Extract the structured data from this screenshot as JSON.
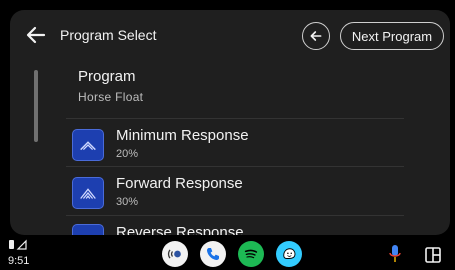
{
  "header": {
    "title": "Program Select",
    "next_label": "Next Program"
  },
  "program": {
    "label": "Program",
    "value": "Horse Float"
  },
  "list": [
    {
      "title": "Minimum Response",
      "subtitle": "20%"
    },
    {
      "title": "Forward Response",
      "subtitle": "30%"
    },
    {
      "title": "Reverse Response",
      "subtitle": ""
    }
  ],
  "status": {
    "time": "9:51"
  },
  "dock_apps": [
    "audible-app",
    "phone-app",
    "spotify-app",
    "waze-app"
  ],
  "colors": {
    "accent_blue": "#1d3fb0",
    "panel": "#1f1f1f",
    "spotify": "#1db954",
    "waze": "#33ccff"
  }
}
